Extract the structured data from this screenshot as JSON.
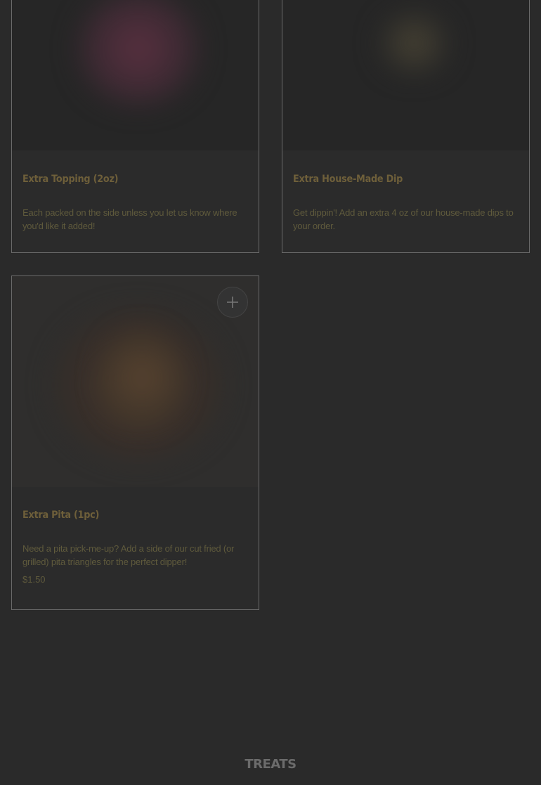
{
  "menu": {
    "items": [
      {
        "title": "Extra Topping (2oz)",
        "description": "Each packed on the side unless you let us know where you'd like it added!",
        "price": "",
        "image_icon": "food-photo"
      },
      {
        "title": "Extra House-Made Dip",
        "description": "Get dippin'! Add an extra 4 oz of our house-made dips to your order.",
        "price": "",
        "image_icon": "food-photo"
      },
      {
        "title": "Extra Pita (1pc)",
        "description": "Need a pita pick-me-up? Add a side of our cut fried (or grilled) pita triangles for the perfect dipper!",
        "price": "$1.50",
        "image_icon": "food-photo",
        "add_icon": "plus-icon"
      }
    ]
  },
  "next_section": {
    "title": "TREATS"
  },
  "colors": {
    "overlay_bg": "#2a2a2a",
    "card_border": "#6a6a6a",
    "title_text": "#6e5f3a",
    "body_text": "#5f5a3c"
  }
}
